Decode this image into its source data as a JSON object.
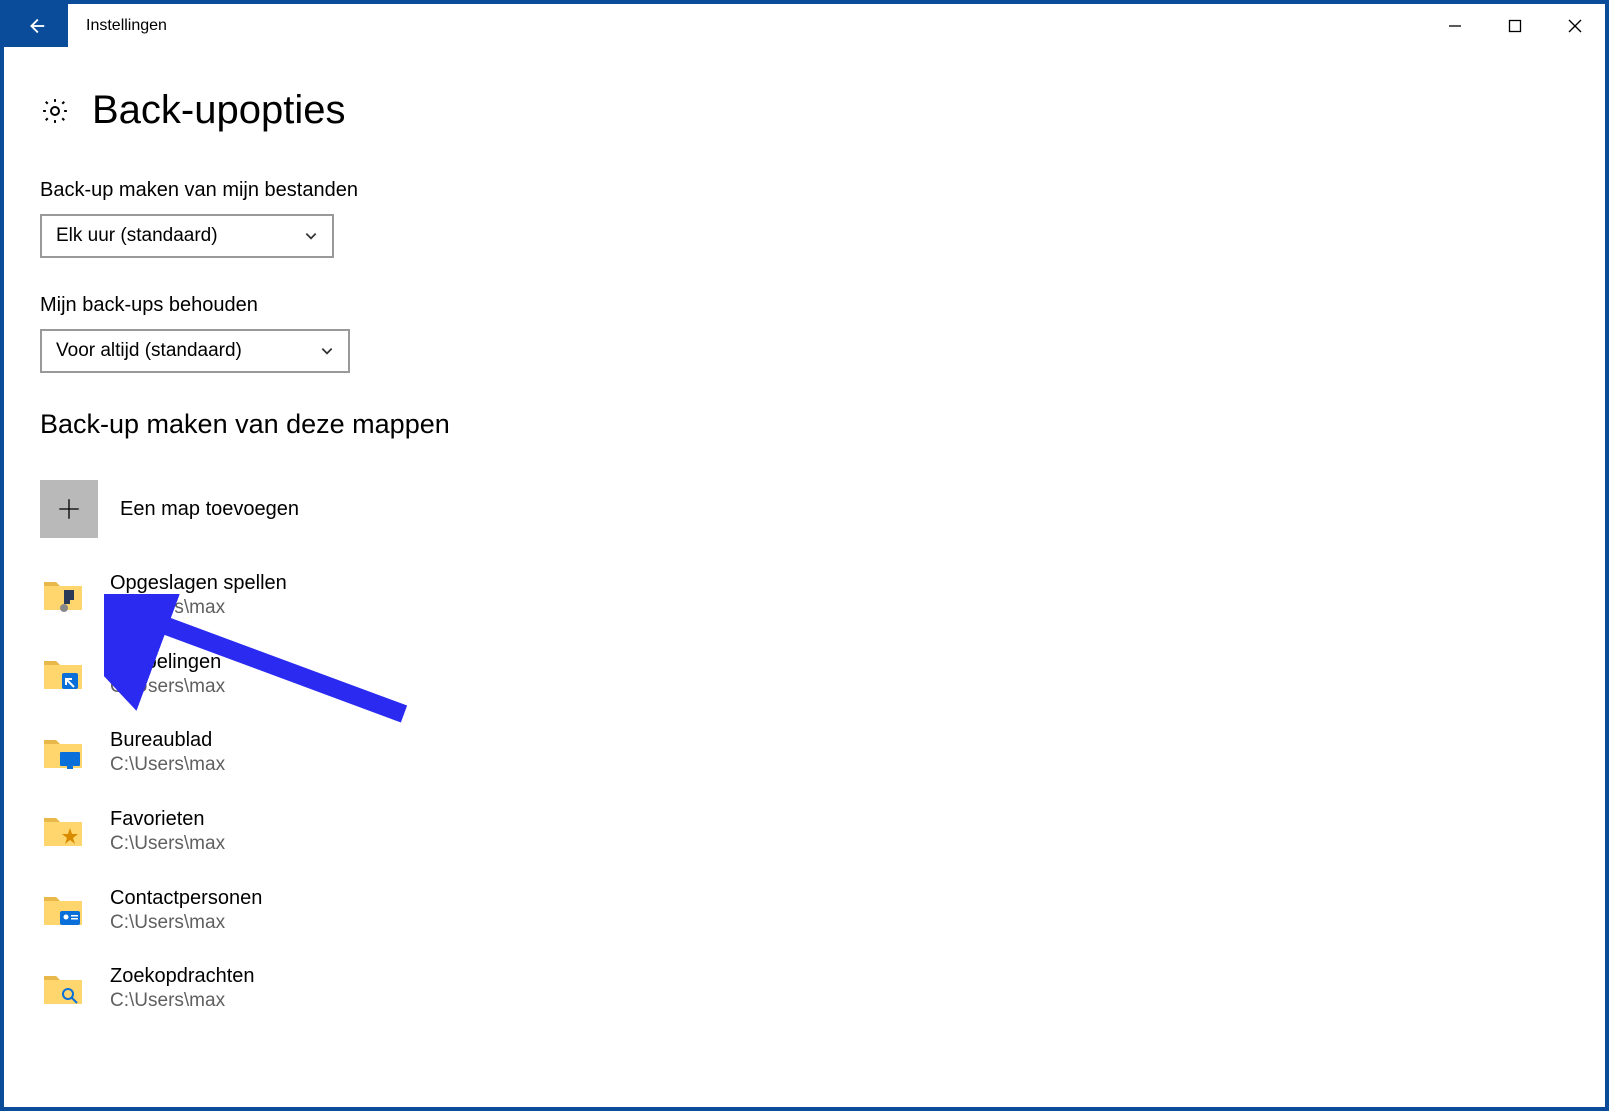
{
  "window": {
    "title": "Instellingen"
  },
  "page": {
    "title": "Back-upopties"
  },
  "backup_frequency": {
    "label": "Back-up maken van mijn bestanden",
    "selected": "Elk uur (standaard)"
  },
  "keep_backups": {
    "label": "Mijn back-ups behouden",
    "selected": "Voor altijd (standaard)"
  },
  "folders_heading": "Back-up maken van deze mappen",
  "add_folder_label": "Een map toevoegen",
  "folders": [
    {
      "name": "Opgeslagen spellen",
      "path": "C:\\Users\\max",
      "icon": "saved-games"
    },
    {
      "name": "Koppelingen",
      "path": "C:\\Users\\max",
      "icon": "links"
    },
    {
      "name": "Bureaublad",
      "path": "C:\\Users\\max",
      "icon": "desktop"
    },
    {
      "name": "Favorieten",
      "path": "C:\\Users\\max",
      "icon": "favorites"
    },
    {
      "name": "Contactpersonen",
      "path": "C:\\Users\\max",
      "icon": "contacts"
    },
    {
      "name": "Zoekopdrachten",
      "path": "C:\\Users\\max",
      "icon": "searches"
    }
  ]
}
